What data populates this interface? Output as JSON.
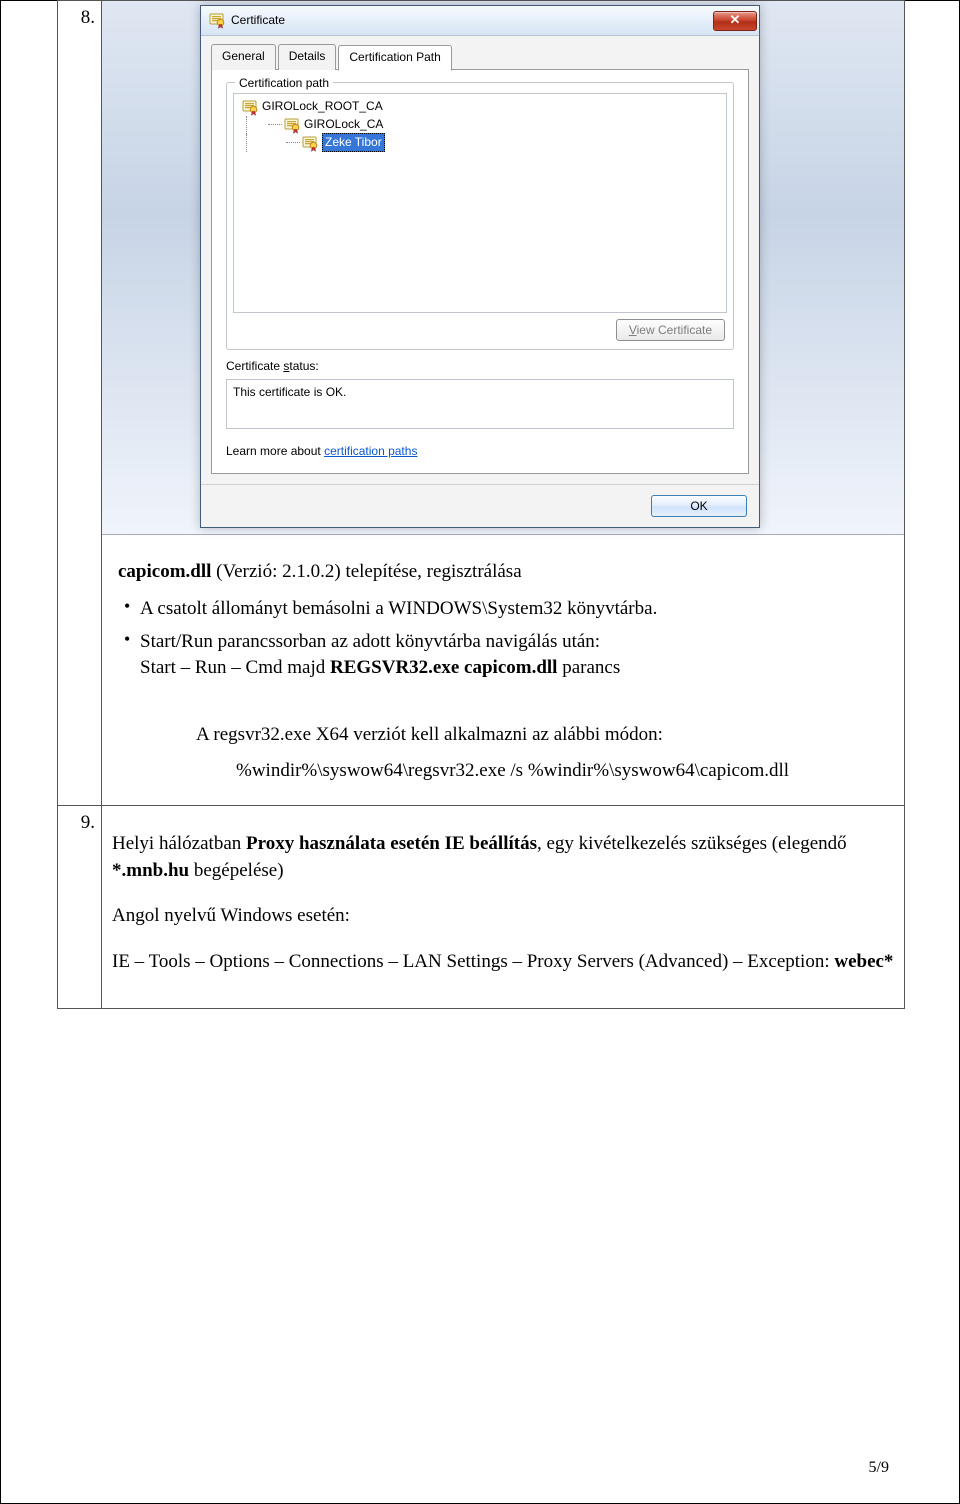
{
  "row8_num": "8.",
  "row9_num": "9.",
  "dialog": {
    "title": "Certificate",
    "tabs": {
      "general": "General",
      "details": "Details",
      "certpath": "Certification Path"
    },
    "group_label": "Certification path",
    "tree": {
      "root": "GIROLock_ROOT_CA",
      "mid": "GIROLock_CA",
      "leaf": "Zeke Tibor"
    },
    "view_btn_pre": "V",
    "view_btn_post": "iew Certificate",
    "status_label_pre": "Certificate ",
    "status_label_u": "s",
    "status_label_post": "tatus:",
    "status_text": "This certificate is OK.",
    "learnmore_pre": "Learn more about ",
    "learnmore_link": "certification paths",
    "ok": "OK"
  },
  "text8": {
    "heading_pre": "capicom.dll",
    "heading_post": " (Verzió: 2.1.0.2) telepítése, regisztrálása",
    "bullet1": "A csatolt állományt bemásolni a WINDOWS\\System32 könyvtárba.",
    "bullet2_line1": "Start/Run parancssorban az adott könyvtárba navigálás után:",
    "bullet2_line2_pre": "Start – Run – Cmd majd ",
    "bullet2_line2_b": "REGSVR32.exe capicom.dll",
    "bullet2_line2_post": " parancs",
    "note": "A regsvr32.exe X64 verziót kell alkalmazni az alábbi módon:",
    "cmd": "%windir%\\syswow64\\regsvr32.exe /s %windir%\\syswow64\\capicom.dll"
  },
  "text9": {
    "line1_pre": "Helyi hálózatban ",
    "line1_b": "Proxy használata esetén IE beállítás",
    "line1_post": ", egy kivételkezelés szükséges (elegendő ",
    "line1_b2": "*.mnb.hu",
    "line1_post2": " begépelése)",
    "line2": "Angol nyelvű Windows esetén:",
    "line3_pre": "IE – Tools – Options – Connections – LAN Settings – Proxy Servers (Advanced) – Exception: ",
    "line3_b": "webec*"
  },
  "pagenum": "5/9"
}
